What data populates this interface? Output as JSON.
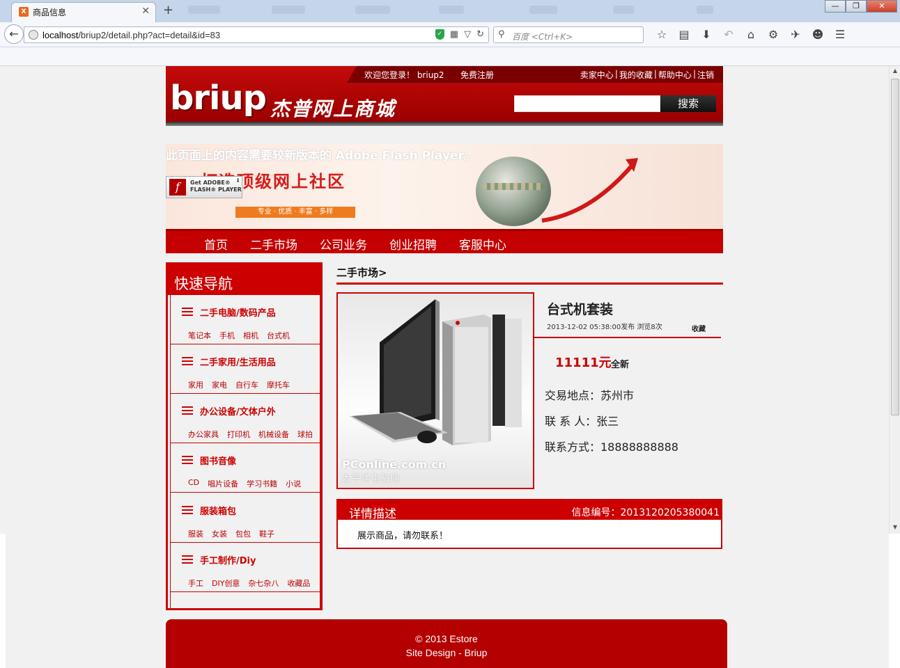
{
  "browser": {
    "tab_title": "商品信息",
    "tab_close": "✕",
    "new_tab": "+",
    "url_host": "localhost",
    "url_path": "/briup2/detail.php?act=detail&id=83",
    "search_placeholder": "百度 <Ctrl+K>",
    "window_buttons": [
      "—",
      "❐",
      "✕"
    ]
  },
  "site": {
    "welcome": "欢迎您登录！ briup2",
    "register": "免费注册",
    "top_links": [
      "卖家中心",
      "我的收藏",
      "帮助中心",
      "注销"
    ],
    "logo": "briup",
    "logo_cn": "杰普网上商城",
    "search_button": "搜索"
  },
  "banner": {
    "flash_message": "此页面上的内容需要较新版本的 Adobe Flash Player。",
    "title": "打造顶级网上社区",
    "tagline": "专业 · 优质 · 丰富 · 多样",
    "flash_badge_line1": "Get ADOBE®",
    "flash_badge_line2": "FLASH® PLAYER"
  },
  "main_nav": [
    "首页",
    "二手市场",
    "公司业务",
    "创业招聘",
    "客服中心"
  ],
  "sidebar": {
    "title": "快速导航",
    "categories": [
      {
        "title": "二手电脑/数码产品",
        "links": [
          "笔记本",
          "手机",
          "相机",
          "台式机"
        ]
      },
      {
        "title": "二手家用/生活用品",
        "links": [
          "家用",
          "家电",
          "自行车",
          "摩托车"
        ]
      },
      {
        "title": "办公设备/文体户外",
        "links": [
          "办公家具",
          "打印机",
          "机械设备",
          "球拍"
        ]
      },
      {
        "title": "图书音像",
        "links": [
          "CD",
          "唱片设备",
          "学习书籍",
          "小说"
        ]
      },
      {
        "title": "服装箱包",
        "links": [
          "服装",
          "女装",
          "包包",
          "鞋子"
        ]
      },
      {
        "title": "手工制作/Diy",
        "links": [
          "手工",
          "DIY创意",
          "杂七杂八",
          "收藏品"
        ]
      }
    ]
  },
  "product": {
    "breadcrumb": "二手市场>",
    "title": "台式机套装",
    "meta": "2013-12-02 05:38:00发布  浏览8次",
    "favorite": "收藏",
    "price": "11111元",
    "condition": "全新",
    "location": "交易地点：苏州市",
    "contact": "联 系 人：张三",
    "phone": "联系方式：18888888888",
    "image_watermark": "PConline.com.cn",
    "image_watermark_cn": "太平洋电脑网"
  },
  "detail": {
    "title": "详情描述",
    "info_no": "信息编号：2013120205380041",
    "body": "展示商品，请勿联系！"
  },
  "footer": {
    "line1": "© 2013 Estore",
    "line2": "Site Design - Briup"
  },
  "colors": {
    "brand_red": "#c40000",
    "dark_red": "#7a0000"
  }
}
